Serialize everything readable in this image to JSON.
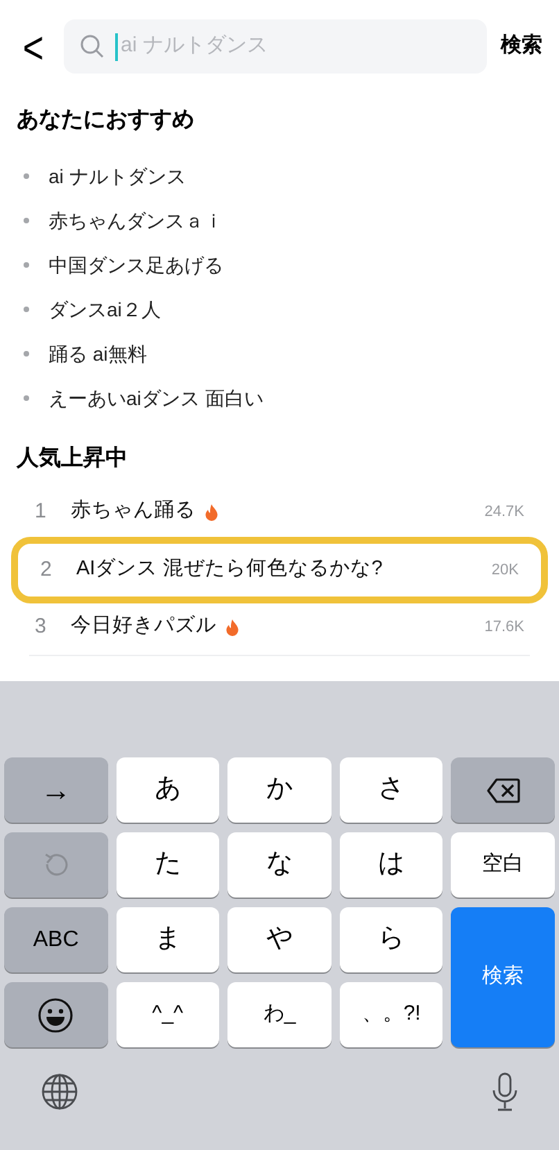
{
  "header": {
    "back": "<",
    "search": {
      "placeholder": "ai ナルトダンス"
    },
    "submit": "検索"
  },
  "recommended": {
    "title": "あなたにおすすめ",
    "items": [
      "ai ナルトダンス",
      "赤ちゃんダンスａｉ",
      "中国ダンス足あげる",
      "ダンスai２人",
      "踊る ai無料",
      "えーあいaiダンス 面白い"
    ]
  },
  "trending": {
    "title": "人気上昇中",
    "rows": [
      {
        "rank": "1",
        "title": "赤ちゃん踊る",
        "hot": true,
        "count": "24.7K",
        "highlighted": false
      },
      {
        "rank": "2",
        "title": "AIダンス 混ぜたら何色なるかな?",
        "hot": false,
        "count": "20K",
        "highlighted": true
      },
      {
        "rank": "3",
        "title": "今日好きパズル",
        "hot": true,
        "count": "17.6K",
        "highlighted": false
      }
    ]
  },
  "keyboard": {
    "keys": [
      {
        "kind": "function",
        "label": "→"
      },
      {
        "kind": "char",
        "label": "あ"
      },
      {
        "kind": "char",
        "label": "か"
      },
      {
        "kind": "char",
        "label": "さ"
      },
      {
        "kind": "backspace"
      },
      {
        "kind": "undo"
      },
      {
        "kind": "char",
        "label": "た"
      },
      {
        "kind": "char",
        "label": "な"
      },
      {
        "kind": "char",
        "label": "は"
      },
      {
        "kind": "char",
        "label": "空白"
      },
      {
        "kind": "function",
        "label": "ABC"
      },
      {
        "kind": "char",
        "label": "ま"
      },
      {
        "kind": "char",
        "label": "や"
      },
      {
        "kind": "char",
        "label": "ら"
      },
      {
        "kind": "enter",
        "label": "検索"
      },
      {
        "kind": "emoji"
      },
      {
        "kind": "char",
        "label": "^_^"
      },
      {
        "kind": "char",
        "label": "わ_"
      },
      {
        "kind": "char",
        "label": "、。?!"
      }
    ]
  }
}
